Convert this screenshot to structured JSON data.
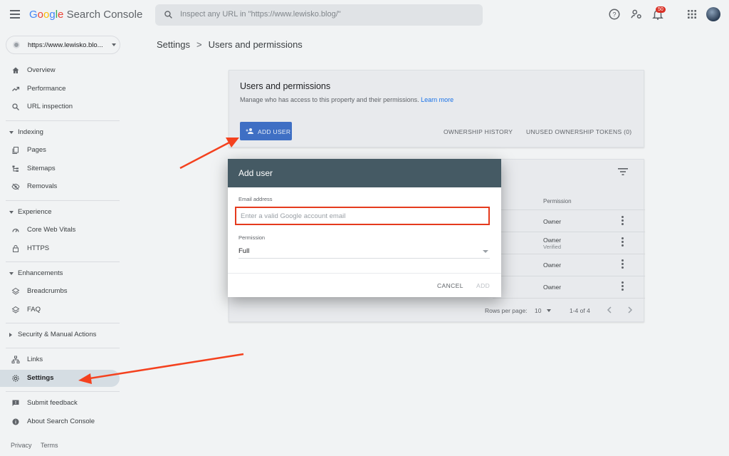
{
  "header": {
    "app_name": "Google Search Console",
    "logo_google": "Google",
    "logo_product": " Search Console",
    "search_placeholder": "Inspect any URL in \"https://www.lewisko.blog/\"",
    "notification_count": "50"
  },
  "sidebar": {
    "property": "https://www.lewisko.blo...",
    "items": [
      {
        "label": "Overview",
        "icon": "home-icon"
      },
      {
        "label": "Performance",
        "icon": "trending-up-icon"
      },
      {
        "label": "URL inspection",
        "icon": "search-icon"
      }
    ],
    "indexing": {
      "header": "Indexing",
      "items": [
        {
          "label": "Pages",
          "icon": "pages-icon"
        },
        {
          "label": "Sitemaps",
          "icon": "sitemap-icon"
        },
        {
          "label": "Removals",
          "icon": "removals-icon"
        }
      ]
    },
    "experience": {
      "header": "Experience",
      "items": [
        {
          "label": "Core Web Vitals",
          "icon": "speedometer-icon"
        },
        {
          "label": "HTTPS",
          "icon": "lock-icon"
        }
      ]
    },
    "enhancements": {
      "header": "Enhancements",
      "items": [
        {
          "label": "Breadcrumbs",
          "icon": "layers-icon"
        },
        {
          "label": "FAQ",
          "icon": "layers-icon"
        }
      ]
    },
    "security": {
      "header": "Security & Manual Actions"
    },
    "bottom_items": [
      {
        "label": "Links",
        "icon": "links-icon"
      },
      {
        "label": "Settings",
        "icon": "gear-icon"
      }
    ],
    "feedback_items": [
      {
        "label": "Submit feedback",
        "icon": "feedback-icon"
      },
      {
        "label": "About Search Console",
        "icon": "info-icon"
      }
    ],
    "footer": {
      "privacy": "Privacy",
      "terms": "Terms"
    }
  },
  "breadcrumb": {
    "parent": "Settings",
    "separator": ">",
    "current": "Users and permissions"
  },
  "users_card": {
    "title": "Users and permissions",
    "description": "Manage who has access to this property and their permissions.",
    "learn_more": "Learn more",
    "add_user_label": "ADD USER",
    "ownership_history_label": "OWNERSHIP HISTORY",
    "unused_tokens_label": "UNUSED OWNERSHIP TOKENS (0)"
  },
  "users_table": {
    "column_permission": "Permission",
    "rows": [
      {
        "permission": "Owner",
        "verified": ""
      },
      {
        "permission": "Owner",
        "verified": "Verified"
      },
      {
        "permission": "Owner",
        "verified": ""
      },
      {
        "permission": "Owner",
        "verified": ""
      }
    ],
    "rows_per_page_label": "Rows per page:",
    "rows_per_page_value": "10",
    "range": "1-4 of 4"
  },
  "dialog": {
    "title": "Add user",
    "email_label": "Email address",
    "email_placeholder": "Enter a valid Google account email",
    "email_value": "",
    "permission_label": "Permission",
    "permission_value": "Full",
    "cancel_label": "CANCEL",
    "add_label": "ADD"
  },
  "colors": {
    "dialog_header": "#455a64",
    "primary_button": "#3f6fc4",
    "highlight_border": "#e53a1d",
    "annotation_arrow": "#f4411e",
    "link": "#1a73e8"
  }
}
